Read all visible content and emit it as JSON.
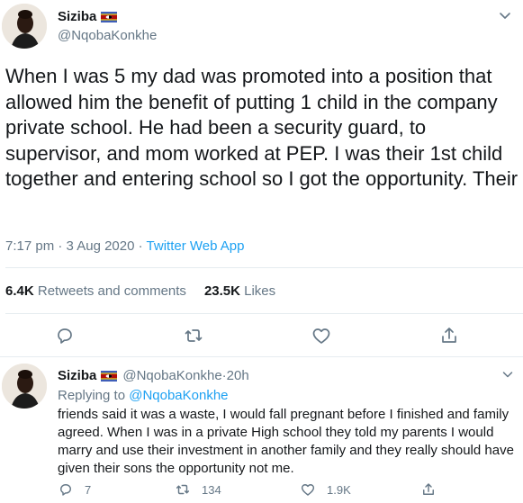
{
  "main_tweet": {
    "author": {
      "display_name": "Siziba",
      "handle": "@NqobaKonkhe",
      "flag_icon": "eswatini-flag-icon"
    },
    "text": "When I was 5 my dad was promoted into a position that allowed him the benefit of putting 1 child in the company private school. He had been a security guard, to supervisor, and mom worked at PEP. I was their 1st child together and entering school so I got the opportunity. Their",
    "time": "7:17 pm",
    "separator1": " · ",
    "date": "3 Aug 2020",
    "separator2": " · ",
    "source": "Twitter Web App",
    "stats": {
      "retweets_count": "6.4K",
      "retweets_label": " Retweets and comments",
      "likes_count": "23.5K",
      "likes_label": " Likes"
    },
    "actions": [
      "reply-icon",
      "retweet-icon",
      "like-icon",
      "share-icon"
    ]
  },
  "reply_tweet": {
    "author": {
      "display_name": "Siziba",
      "handle": "@NqobaKonkhe",
      "dot": " · ",
      "age": "20h"
    },
    "replying_prefix": "Replying to ",
    "replying_to": "@NqobaKonkhe",
    "text": "friends said it was a waste, I would fall pregnant before I finished and family agreed. When I was in a private High school they told my parents I would marry and use their investment in another family and they really should have given their sons the opportunity not me.",
    "counts": {
      "replies": "7",
      "retweets": "134",
      "likes": "1.9K"
    }
  },
  "colors": {
    "text": "#14171a",
    "secondary": "#657786",
    "accent": "#1da1f2",
    "divider": "#e6ecf0",
    "flag_blue": "#3e5eb9",
    "flag_yellow": "#ffd900",
    "flag_red": "#b10c0c"
  }
}
